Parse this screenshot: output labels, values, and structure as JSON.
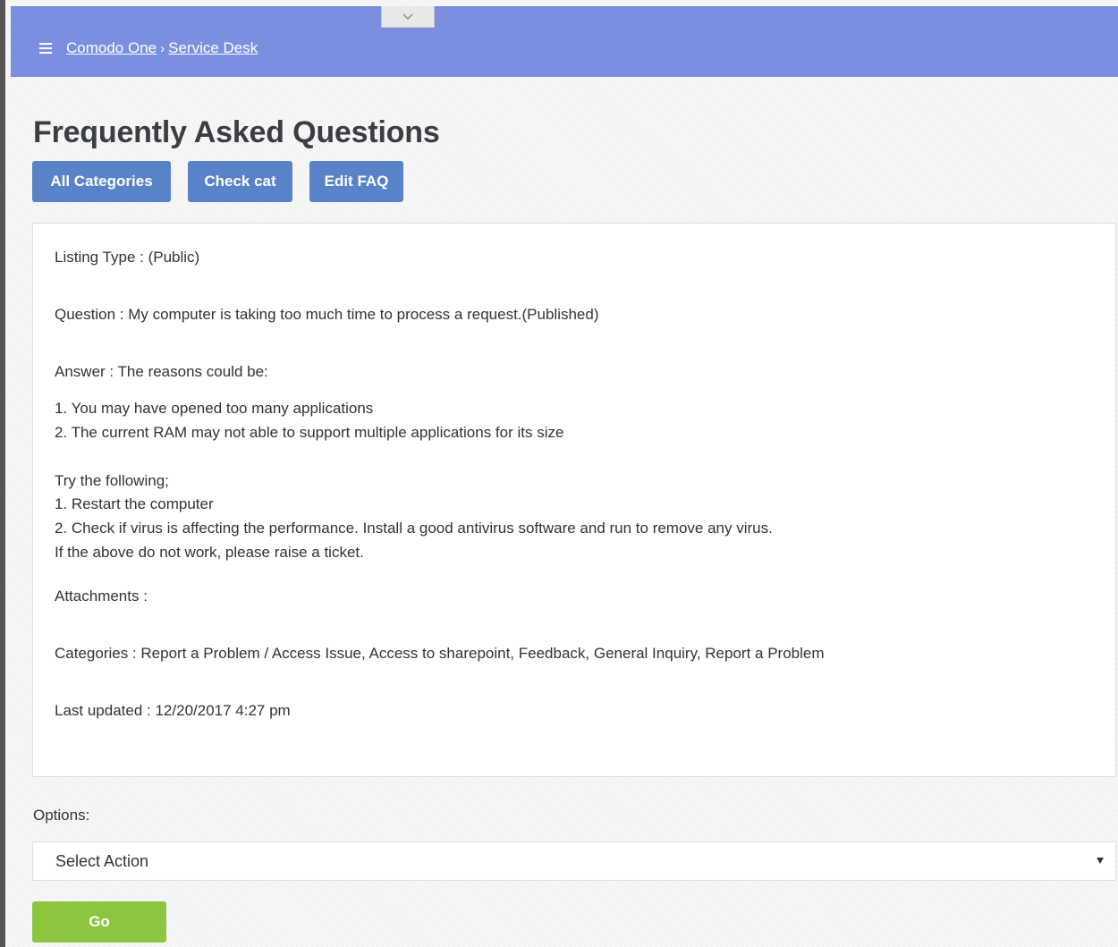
{
  "header": {
    "breadcrumb": [
      "Comodo One",
      "Service Desk"
    ],
    "breadcrumb_separator": "›",
    "color": "#7b8fe0"
  },
  "page": {
    "title": "Frequently Asked Questions"
  },
  "tabs": [
    {
      "label": "All Categories"
    },
    {
      "label": "Check cat"
    },
    {
      "label": "Edit FAQ"
    }
  ],
  "faq": {
    "listing_type": "Listing Type : (Public)",
    "question": "Question : My computer is taking too much time to process a request.(Published)",
    "answer_label": "Answer : The reasons could be:",
    "answer_lines": [
      "1. You may have opened too many applications",
      "2. The current RAM may not able to support multiple applications for its size",
      "Try the following;",
      "1. Restart the computer",
      "2. Check if virus is affecting the performance. Install a good antivirus software and run to remove any virus.",
      "If the above do not work, please raise a ticket."
    ],
    "attachments": "Attachments :",
    "categories": "Categories : Report a Problem / Access Issue, Access to sharepoint, Feedback, General Inquiry, Report a Problem",
    "last_updated": "Last updated : 12/20/2017 4:27 pm"
  },
  "options": {
    "label": "Options:",
    "select_value": "Select Action",
    "go_label": "Go"
  },
  "colors": {
    "tab_button": "#5983c9",
    "go_button": "#8cc63f"
  },
  "icons": {
    "menu": "hamburger-icon",
    "collapse": "chevron-down-icon",
    "select_arrow": "caret-down-icon"
  }
}
